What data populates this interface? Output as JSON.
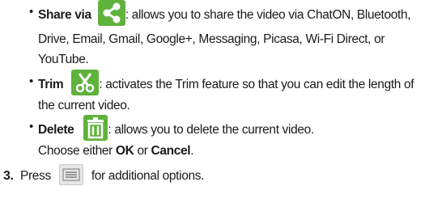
{
  "share": {
    "term": "Share via",
    "desc_line1": ": allows you to share the video via ChatON, Bluetooth,",
    "desc_line2": "Drive, Email, Gmail, Google+, Messaging, Picasa, Wi-Fi Direct, or",
    "desc_line3": "YouTube.",
    "icon": "share-icon"
  },
  "trim": {
    "term": "Trim",
    "desc_line1": ": activates the Trim feature so that you can edit the length of",
    "desc_line2": "the current video.",
    "icon": "scissors-icon"
  },
  "delete": {
    "term": "Delete",
    "desc_line1": ": allows you to delete the current video.",
    "line2_pre": "Choose either ",
    "ok": "OK",
    "line2_mid": " or ",
    "cancel": "Cancel",
    "line2_post": ".",
    "icon": "trash-icon"
  },
  "step3": {
    "number": "3.",
    "pre": "Press",
    "post": "for additional options.",
    "icon": "menu-icon"
  },
  "bullet_char": "•",
  "colors": {
    "icon_green": "#5fb23b",
    "text": "#1a1a1a"
  }
}
